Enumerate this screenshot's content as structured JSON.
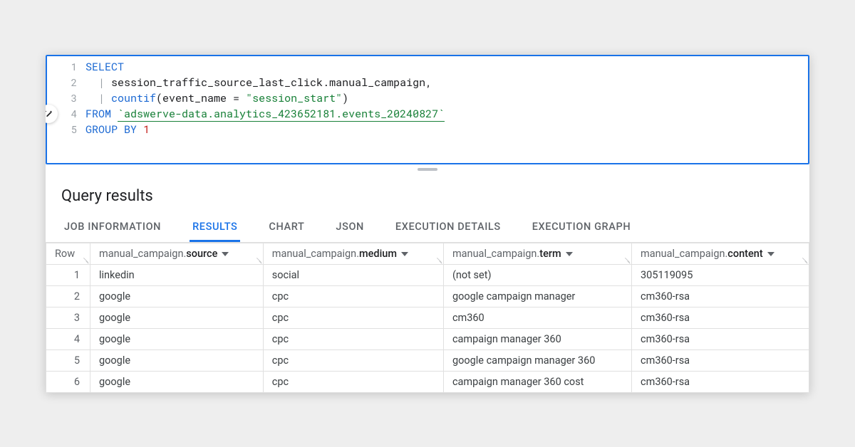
{
  "editor": {
    "lines": [
      {
        "n": "1",
        "tokens": [
          {
            "cls": "kw",
            "t": "SELECT"
          }
        ]
      },
      {
        "n": "2",
        "tokens": [
          {
            "cls": "bar",
            "t": "  | "
          },
          {
            "cls": "plain",
            "t": "session_traffic_source_last_click.manual_campaign,"
          }
        ]
      },
      {
        "n": "3",
        "tokens": [
          {
            "cls": "bar",
            "t": "  | "
          },
          {
            "cls": "fn",
            "t": "countif"
          },
          {
            "cls": "plain",
            "t": "(event_name = "
          },
          {
            "cls": "str",
            "t": "\"session_start\""
          },
          {
            "cls": "plain",
            "t": ")"
          }
        ]
      },
      {
        "n": "4",
        "wand": true,
        "tokens": [
          {
            "cls": "kw",
            "t": "FROM"
          },
          {
            "cls": "plain",
            "t": " "
          },
          {
            "cls": "tbl",
            "t": "`adswerve-data.analytics_423652181.events_20240827`"
          }
        ]
      },
      {
        "n": "5",
        "tokens": [
          {
            "cls": "kw",
            "t": "GROUP"
          },
          {
            "cls": "plain",
            "t": " "
          },
          {
            "cls": "kw",
            "t": "BY"
          },
          {
            "cls": "plain",
            "t": " "
          },
          {
            "cls": "num",
            "t": "1"
          }
        ]
      }
    ]
  },
  "results": {
    "title": "Query results",
    "tabs": [
      {
        "label": "JOB INFORMATION",
        "active": false
      },
      {
        "label": "RESULTS",
        "active": true
      },
      {
        "label": "CHART",
        "active": false
      },
      {
        "label": "JSON",
        "active": false
      },
      {
        "label": "EXECUTION DETAILS",
        "active": false
      },
      {
        "label": "EXECUTION GRAPH",
        "active": false
      }
    ],
    "row_header": "Row",
    "col_prefix": "manual_campaign.",
    "columns": [
      {
        "suffix": "source"
      },
      {
        "suffix": "medium"
      },
      {
        "suffix": "term"
      },
      {
        "suffix": "content"
      }
    ],
    "rows": [
      {
        "n": "1",
        "cells": [
          "linkedin",
          "social",
          "(not set)",
          "305119095"
        ]
      },
      {
        "n": "2",
        "cells": [
          "google",
          "cpc",
          "google campaign manager",
          "cm360-rsa"
        ]
      },
      {
        "n": "3",
        "cells": [
          "google",
          "cpc",
          "cm360",
          "cm360-rsa"
        ]
      },
      {
        "n": "4",
        "cells": [
          "google",
          "cpc",
          "campaign manager 360",
          "cm360-rsa"
        ]
      },
      {
        "n": "5",
        "cells": [
          "google",
          "cpc",
          "google campaign manager 360",
          "cm360-rsa"
        ]
      },
      {
        "n": "6",
        "cells": [
          "google",
          "cpc",
          "campaign manager 360 cost",
          "cm360-rsa"
        ]
      }
    ]
  }
}
